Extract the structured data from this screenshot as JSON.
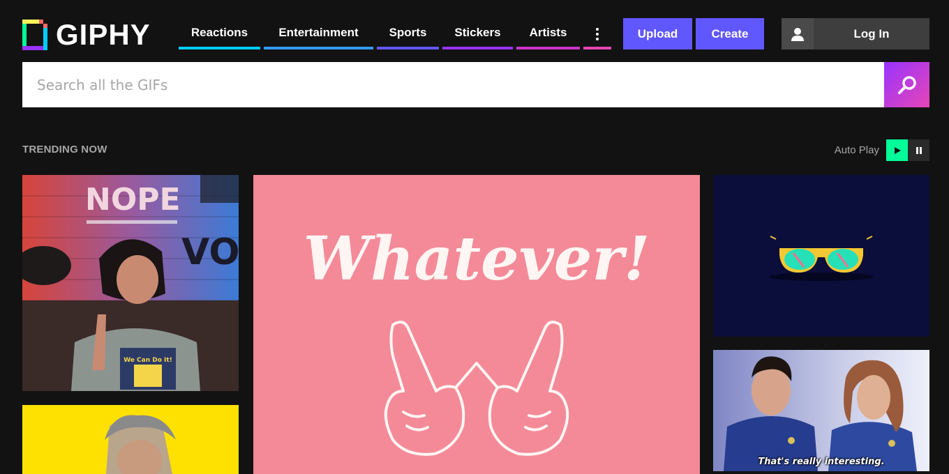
{
  "brand": {
    "name": "GIPHY"
  },
  "nav": {
    "items": [
      {
        "label": "Reactions",
        "color": "#00ccff"
      },
      {
        "label": "Entertainment",
        "color": "#3399ff"
      },
      {
        "label": "Sports",
        "color": "#6157ff"
      },
      {
        "label": "Stickers",
        "color": "#9933ff"
      },
      {
        "label": "Artists",
        "color": "#cc33cc"
      }
    ],
    "more_color": "#e646b6"
  },
  "actions": {
    "upload": "Upload",
    "create": "Create",
    "login": "Log In"
  },
  "search": {
    "placeholder": "Search all the GIFs"
  },
  "trending": {
    "title": "TRENDING NOW",
    "autoplay_label": "Auto Play"
  },
  "gifs": [
    {
      "id": "nope",
      "sign_text": "NOPE",
      "wall_text": "VO",
      "shirt_text": "We Can Do It!"
    },
    {
      "id": "yellow-guy"
    },
    {
      "id": "whatever",
      "text": "Whatever!"
    },
    {
      "id": "sunglasses"
    },
    {
      "id": "orville",
      "caption": "That's really interesting."
    }
  ],
  "colors": {
    "accent": "#6157ff",
    "autoplay_on": "#00ff99"
  }
}
